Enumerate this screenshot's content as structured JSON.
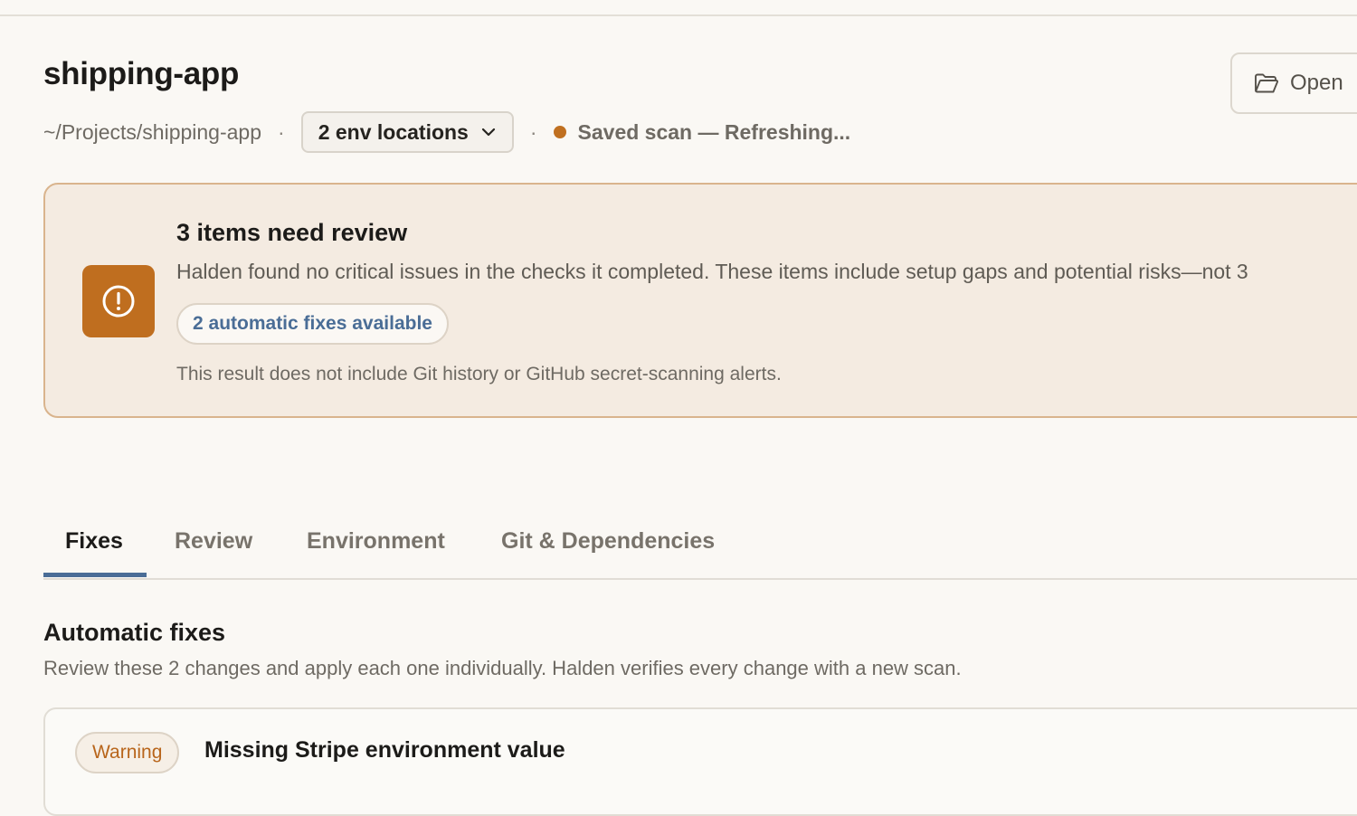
{
  "header": {
    "title": "shipping-app",
    "path": "~/Projects/shipping-app",
    "separator": "·",
    "env_dropdown_label": "2 env locations",
    "status_text": "Saved scan — Refreshing...",
    "open_button_label": "Open"
  },
  "review_card": {
    "title": "3 items need review",
    "description": "Halden found no critical issues in the checks it completed. These items include setup gaps and potential risks—not 3",
    "fix_pill_label": "2 automatic fixes available",
    "note": "This result does not include Git history or GitHub secret-scanning alerts."
  },
  "tabs": [
    {
      "label": "Fixes",
      "active": true
    },
    {
      "label": "Review",
      "active": false
    },
    {
      "label": "Environment",
      "active": false
    },
    {
      "label": "Git & Dependencies",
      "active": false
    }
  ],
  "fixes_section": {
    "title": "Automatic fixes",
    "description": "Review these 2 changes and apply each one individually. Halden verifies every change with a new scan."
  },
  "fix_items": [
    {
      "severity": "Warning",
      "title": "Missing Stripe environment value"
    }
  ],
  "colors": {
    "background": "#faf8f4",
    "accent_blue": "#4a6d96",
    "warning_orange": "#bf6e1f",
    "card_bg": "#f4ebe1"
  },
  "icons": [
    "chevron-down-icon",
    "folder-open-icon",
    "alert-circle-icon"
  ]
}
